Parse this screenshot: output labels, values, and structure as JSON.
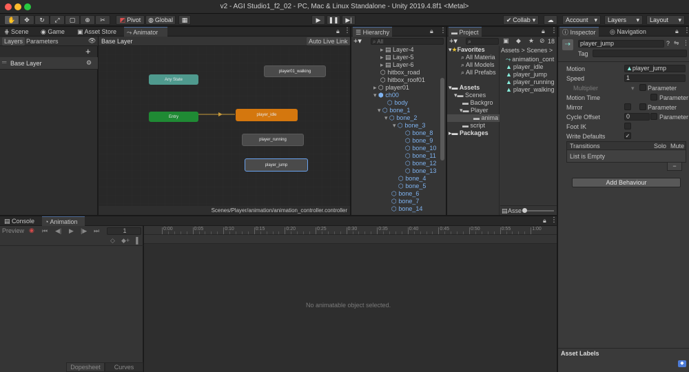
{
  "window": {
    "title": "v2 - AGI Studio1_f2_02 - PC, Mac & Linux Standalone - Unity 2019.4.8f1 <Metal>"
  },
  "toolbar": {
    "pivot": "Pivot",
    "global": "Global",
    "collab": "Collab",
    "account": "Account",
    "layers": "Layers",
    "layout": "Layout"
  },
  "tabs": {
    "scene": "Scene",
    "game": "Game",
    "asset_store": "Asset Store",
    "animator": "Animator",
    "hierarchy": "Hierarchy",
    "project": "Project",
    "inspector": "Inspector",
    "navigation": "Navigation",
    "console": "Console",
    "animation": "Animation"
  },
  "animator": {
    "layers_tab": "Layers",
    "parameters_tab": "Parameters",
    "breadcrumb": "Base Layer",
    "auto_live_link": "Auto Live Link",
    "layer_name": "Base Layer",
    "footer_path": "Scenes/Player/animation/animation_controller.controller",
    "nodes": {
      "any_state": "Any State",
      "entry": "Entry",
      "walking": "player01_walking",
      "idle": "player_idle",
      "running": "player_running",
      "jump": "player_jump"
    }
  },
  "hierarchy": {
    "search_placeholder": "All",
    "items": [
      {
        "label": "Layer-4"
      },
      {
        "label": "Layer-5"
      },
      {
        "label": "Layer-6"
      },
      {
        "label": "hitbox_road"
      },
      {
        "label": "hitbox_roof01"
      },
      {
        "label": "player01"
      },
      {
        "label": "ch00"
      },
      {
        "label": "body"
      },
      {
        "label": "bone_1"
      },
      {
        "label": "bone_2"
      },
      {
        "label": "bone_3"
      },
      {
        "label": "bone_8"
      },
      {
        "label": "bone_9"
      },
      {
        "label": "bone_10"
      },
      {
        "label": "bone_11"
      },
      {
        "label": "bone_12"
      },
      {
        "label": "bone_13"
      },
      {
        "label": "bone_4"
      },
      {
        "label": "bone_5"
      },
      {
        "label": "bone_6"
      },
      {
        "label": "bone_7"
      },
      {
        "label": "bone_14"
      }
    ]
  },
  "project": {
    "count": "18",
    "favorites": "Favorites",
    "fav_items": [
      "All Materia",
      "All Models",
      "All Prefabs"
    ],
    "assets": "Assets",
    "scenes": "Scenes",
    "backgro": "Backgro",
    "player": "Player",
    "anima": "anima",
    "script": "script",
    "packages": "Packages",
    "breadcrumb_assets": "Assets",
    "breadcrumb_sep": ">",
    "breadcrumb_scenes": "Scenes",
    "files": [
      "animation_cont",
      "player_idle",
      "player_jump",
      "player_running",
      "player_walking"
    ],
    "footer_label": "Asse"
  },
  "inspector": {
    "object_name": "player_jump",
    "tag_label": "Tag",
    "motion_label": "Motion",
    "motion_value": "player_jump",
    "speed_label": "Speed",
    "speed_value": "1",
    "multiplier_label": "Multiplier",
    "parameter": "Parameter",
    "motion_time_label": "Motion Time",
    "mirror_label": "Mirror",
    "cycle_offset_label": "Cycle Offset",
    "cycle_offset_value": "0",
    "foot_ik_label": "Foot IK",
    "write_defaults_label": "Write Defaults",
    "transitions_header": "Transitions",
    "solo": "Solo",
    "mute": "Mute",
    "list_empty": "List is Empty",
    "remove_symbol": "−",
    "add_behaviour": "Add Behaviour",
    "asset_labels": "Asset Labels"
  },
  "animation": {
    "preview": "Preview",
    "frame": "1",
    "ticks": [
      "0:00",
      "0:05",
      "0:10",
      "0:15",
      "0:20",
      "0:25",
      "0:30",
      "0:35",
      "0:40",
      "0:45",
      "0:50",
      "0:55",
      "1:00"
    ],
    "empty_message": "No animatable object selected.",
    "dopesheet": "Dopesheet",
    "curves": "Curves"
  },
  "colors": {
    "accent": "#4d6a97",
    "any_state": "#4f9a8e",
    "entry": "#1f8a34",
    "idle": "#d4770e",
    "node_gray": "#4a4a4a"
  }
}
